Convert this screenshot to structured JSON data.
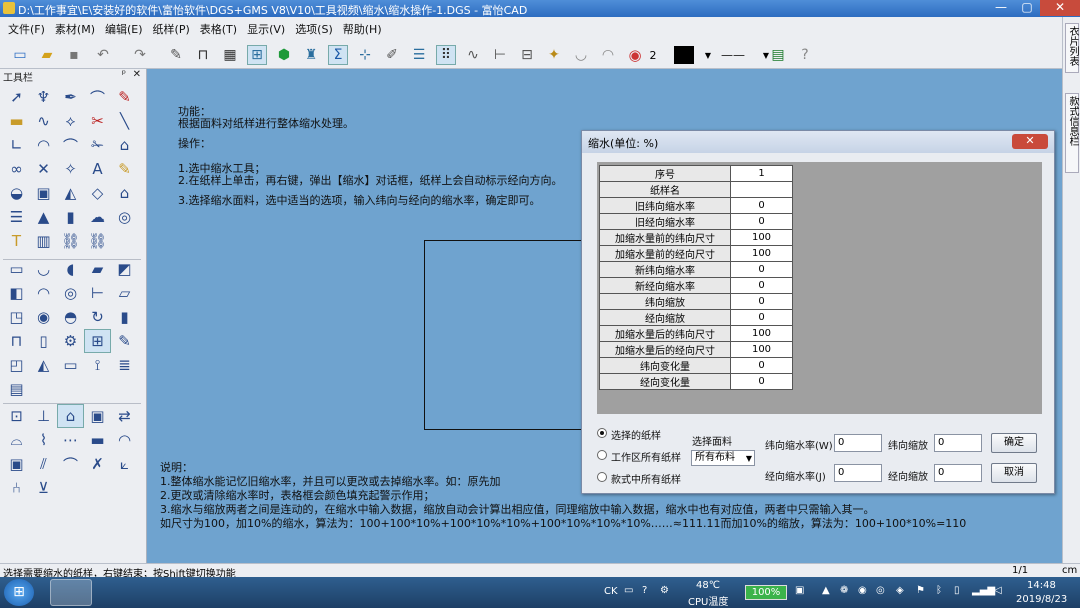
{
  "window": {
    "title": "D:\\工作事宜\\E\\安装好的软件\\富怡软件\\DGS+GMS V8\\V10\\工具视频\\缩水\\缩水操作-1.DGS - 富怡CAD",
    "min": "—",
    "max": "▢",
    "close": "✕"
  },
  "menu": [
    "文件(F)",
    "素材(M)",
    "编辑(E)",
    "纸样(P)",
    "表格(T)",
    "显示(V)",
    "选项(S)",
    "帮助(H)"
  ],
  "toolbar": {
    "line_width_value": "2"
  },
  "right_tabs": [
    "衣片列表",
    "款式信息栏"
  ],
  "tool_panel": {
    "title": "工具栏",
    "pin": "ᵖ",
    "close": "✕"
  },
  "canvas_text": {
    "func_label": "功能：",
    "func_desc": "根据面料对纸样进行整体缩水处理。",
    "op_label": "操作：",
    "step1": "1.选中缩水工具；",
    "step2": "2.在纸样上单击，再右键，弹出【缩水】对话框，纸样上会自动标示经向方向。",
    "step3": "3.选择缩水面料，选中适当的选项，输入纬向与经向的缩水率，确定即可。",
    "note_label": "说明：",
    "note1": "1.整体缩水能记忆旧缩水率，并且可以更改或去掉缩水率。如：原先加",
    "note2": "2.更改或清除缩水率时，表格框会颜色填充起警示作用；",
    "note3": "3.缩水与缩放两者之间是连动的，在缩水中输入数据，缩放自动会计算出相应值，同理缩放中输入数据，缩水中也有对应值，两者中只需输入其一。",
    "note4": "如尺寸为100，加10%的缩水，算法为：100+100*10%+100*10%*10%+100*10%*10%*10%……≈111.11而加10%的缩放，算法为：100+100*10%=110"
  },
  "dialog": {
    "title": "缩水(单位: %)",
    "close": "✕",
    "rows": [
      {
        "label": "序号",
        "value": "1"
      },
      {
        "label": "纸样名",
        "value": ""
      },
      {
        "label": "旧纬向缩水率",
        "value": "0"
      },
      {
        "label": "旧经向缩水率",
        "value": "0"
      },
      {
        "label": "加缩水量前的纬向尺寸",
        "value": "100"
      },
      {
        "label": "加缩水量前的经向尺寸",
        "value": "100"
      },
      {
        "label": "新纬向缩水率",
        "value": "0"
      },
      {
        "label": "新经向缩水率",
        "value": "0"
      },
      {
        "label": "纬向缩放",
        "value": "0"
      },
      {
        "label": "经向缩放",
        "value": "0"
      },
      {
        "label": "加缩水量后的纬向尺寸",
        "value": "100"
      },
      {
        "label": "加缩水量后的经向尺寸",
        "value": "100"
      },
      {
        "label": "纬向变化量",
        "value": "0"
      },
      {
        "label": "经向变化量",
        "value": "0"
      }
    ],
    "radio_selected": "选择的纸样",
    "radio_workspace": "工作区所有纸样",
    "radio_style": "款式中所有纸样",
    "fabric_label": "选择面料",
    "fabric_value": "所有布料",
    "weft_shrink_label": "纬向缩水率(W)",
    "weft_shrink_value": "0",
    "warp_shrink_label": "经向缩水率(J)",
    "warp_shrink_value": "0",
    "weft_scale_label": "纬向缩放",
    "weft_scale_value": "0",
    "warp_scale_label": "经向缩放",
    "warp_scale_value": "0",
    "ok": "确定",
    "cancel": "取消"
  },
  "status": {
    "message": "选择需要缩水的纸样，右键结束；按Shift键切换功能",
    "page": "1/1",
    "unit": "cm"
  },
  "taskbar": {
    "input_method": "CK",
    "cpu_temp": "48℃",
    "cpu_label": "CPU温度",
    "battery": "100%",
    "time": "14:48",
    "date": "2019/8/23"
  }
}
